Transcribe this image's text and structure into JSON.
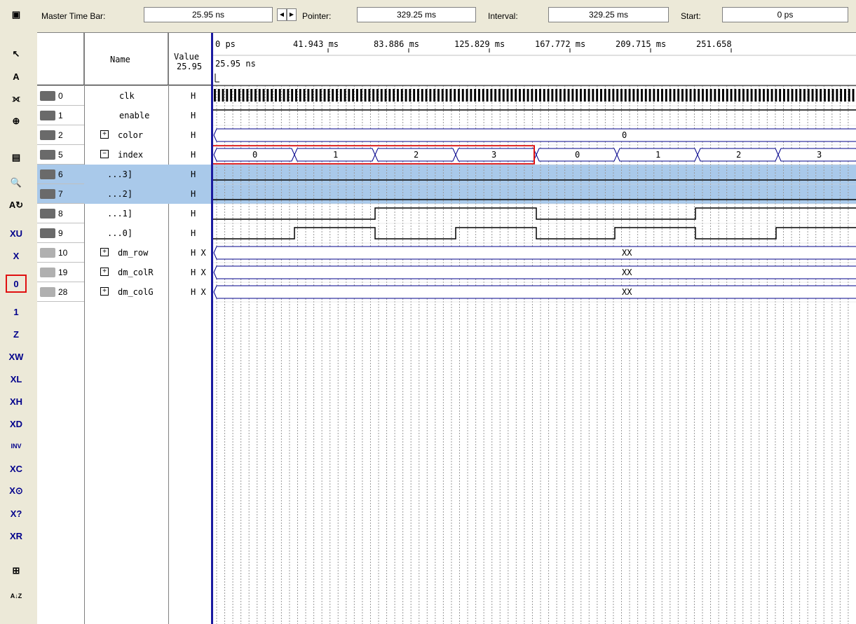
{
  "toolbar": {
    "tools": [
      {
        "name": "window-icon",
        "glyph": "▣"
      },
      {
        "name": "pointer-icon",
        "glyph": "↖"
      },
      {
        "name": "text-tool-icon",
        "glyph": "A"
      },
      {
        "name": "waveform-editing-icon",
        "glyph": "⟗"
      },
      {
        "name": "zoom-icon",
        "glyph": "⊕"
      },
      {
        "name": "fullscreen-icon",
        "glyph": "▤"
      },
      {
        "name": "find-icon",
        "glyph": "🔍"
      },
      {
        "name": "replace-icon",
        "glyph": "A↻"
      },
      {
        "name": "uninitialized-icon",
        "glyph": "XU"
      },
      {
        "name": "unknown-icon",
        "glyph": "X"
      },
      {
        "name": "forcing-low-icon",
        "glyph": "0"
      },
      {
        "name": "forcing-high-icon",
        "glyph": "1"
      },
      {
        "name": "high-impedance-icon",
        "glyph": "Z"
      },
      {
        "name": "weak-unknown-icon",
        "glyph": "XW"
      },
      {
        "name": "weak-low-icon",
        "glyph": "XL"
      },
      {
        "name": "weak-high-icon",
        "glyph": "XH"
      },
      {
        "name": "dont-care-icon",
        "glyph": "XD"
      },
      {
        "name": "invert-icon",
        "glyph": "INV"
      },
      {
        "name": "count-value-icon",
        "glyph": "XC"
      },
      {
        "name": "clock-value-icon",
        "glyph": "X⊙"
      },
      {
        "name": "arbitrary-value-icon",
        "glyph": "X?"
      },
      {
        "name": "random-values-icon",
        "glyph": "XR"
      },
      {
        "name": "snap-to-grid-icon",
        "glyph": "⊞"
      },
      {
        "name": "sort-icon",
        "glyph": "A↓Z"
      }
    ]
  },
  "topbar": {
    "master_label": "Master Time Bar:",
    "master_value": "25.95 ns",
    "pointer_label": "Pointer:",
    "pointer_value": "329.25 ms",
    "interval_label": "Interval:",
    "interval_value": "329.25 ms",
    "start_label": "Start:",
    "start_value": "0 ps"
  },
  "grid_header": {
    "name_col": "Name",
    "value_col": "Value",
    "value_sub": "25.95",
    "time_marker": "25.95 ns",
    "time_ticks": [
      "0 ps",
      "41.943 ms",
      "83.886 ms",
      "125.829 ms",
      "167.772 ms",
      "209.715 ms",
      "251.658"
    ]
  },
  "signals": [
    {
      "num": "0",
      "name": "clk",
      "value": "H",
      "type": "in"
    },
    {
      "num": "1",
      "name": "enable",
      "value": "H",
      "type": "in"
    },
    {
      "num": "2",
      "name": "color",
      "value": "H",
      "type": "in",
      "expand": "+"
    },
    {
      "num": "5",
      "name": "index",
      "value": "H",
      "type": "in",
      "expand": "−"
    },
    {
      "num": "6",
      "name": "...3]",
      "value": "H",
      "type": "in",
      "child": true
    },
    {
      "num": "7",
      "name": "...2]",
      "value": "H",
      "type": "in",
      "child": true
    },
    {
      "num": "8",
      "name": "...1]",
      "value": "H",
      "type": "in",
      "child": true
    },
    {
      "num": "9",
      "name": "...0]",
      "value": "H",
      "type": "in",
      "child": true
    },
    {
      "num": "10",
      "name": "dm_row",
      "value": "H X",
      "type": "out",
      "expand": "+"
    },
    {
      "num": "19",
      "name": "dm_colR",
      "value": "H X",
      "type": "out",
      "expand": "+"
    },
    {
      "num": "28",
      "name": "dm_colG",
      "value": "H X",
      "type": "out",
      "expand": "+"
    }
  ],
  "bus_values": {
    "color": "0",
    "index": [
      "0",
      "1",
      "2",
      "3",
      "0",
      "1",
      "2",
      "3"
    ],
    "dm_row": "XX",
    "dm_colR": "XX",
    "dm_colG": "XX"
  },
  "colors": {
    "bus": "#00008b",
    "selection": "#a9c9ea",
    "highlight": "#e01010"
  }
}
